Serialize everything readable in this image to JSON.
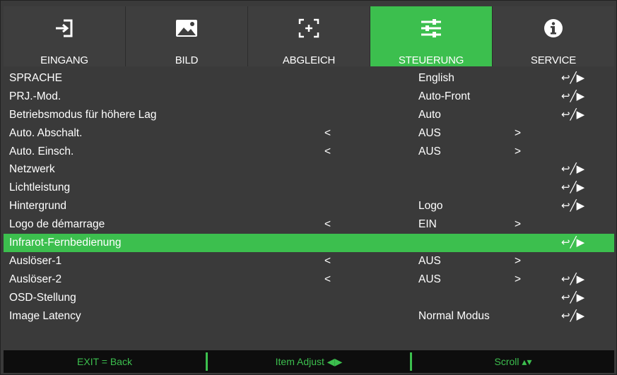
{
  "tabs": [
    {
      "label": "EINGANG",
      "icon": "input-icon",
      "active": false
    },
    {
      "label": "BILD",
      "icon": "image-icon",
      "active": false
    },
    {
      "label": "ABGLEICH",
      "icon": "alignment-icon",
      "active": false
    },
    {
      "label": "STEUERUNG",
      "icon": "sliders-icon",
      "active": true
    },
    {
      "label": "SERVICE",
      "icon": "info-icon",
      "active": false
    }
  ],
  "rows": [
    {
      "label": "SPRACHE",
      "value": "English",
      "left_arrow": "",
      "right_arrow": "",
      "action": "↩╱▶"
    },
    {
      "label": "PRJ.-Mod.",
      "value": "Auto-Front",
      "left_arrow": "",
      "right_arrow": "",
      "action": "↩╱▶"
    },
    {
      "label": "Betriebsmodus für höhere Lag",
      "value": "Auto",
      "left_arrow": "",
      "right_arrow": "",
      "action": "↩╱▶"
    },
    {
      "label": "Auto. Abschalt.",
      "value": "AUS",
      "left_arrow": "<",
      "right_arrow": ">",
      "action": ""
    },
    {
      "label": "Auto. Einsch.",
      "value": "AUS",
      "left_arrow": "<",
      "right_arrow": ">",
      "action": ""
    },
    {
      "label": "Netzwerk",
      "value": "",
      "left_arrow": "",
      "right_arrow": "",
      "action": "↩╱▶"
    },
    {
      "label": "Lichtleistung",
      "value": "",
      "left_arrow": "",
      "right_arrow": "",
      "action": "↩╱▶"
    },
    {
      "label": "Hintergrund",
      "value": "Logo",
      "left_arrow": "",
      "right_arrow": "",
      "action": "↩╱▶"
    },
    {
      "label": "Logo de démarrage",
      "value": "EIN",
      "left_arrow": "<",
      "right_arrow": ">",
      "action": ""
    },
    {
      "label": "Infrarot-Fernbedienung",
      "value": "",
      "left_arrow": "",
      "right_arrow": "",
      "action": "↩╱▶",
      "selected": true
    },
    {
      "label": "Auslöser-1",
      "value": "AUS",
      "left_arrow": "<",
      "right_arrow": ">",
      "action": ""
    },
    {
      "label": "Auslöser-2",
      "value": "AUS",
      "left_arrow": "<",
      "right_arrow": ">",
      "action": "↩╱▶"
    },
    {
      "label": "OSD-Stellung",
      "value": "",
      "left_arrow": "",
      "right_arrow": "",
      "action": "↩╱▶"
    },
    {
      "label": "Image Latency",
      "value": "Normal Modus",
      "left_arrow": "",
      "right_arrow": "",
      "action": "↩╱▶"
    }
  ],
  "footer": {
    "exit": "EXIT = Back",
    "adjust": "Item Adjust ◀▶",
    "scroll": "Scroll ▴▾"
  },
  "colors": {
    "accent": "#3cbf4e",
    "background": "#3a3a3a",
    "footer": "#0d0d0d"
  }
}
